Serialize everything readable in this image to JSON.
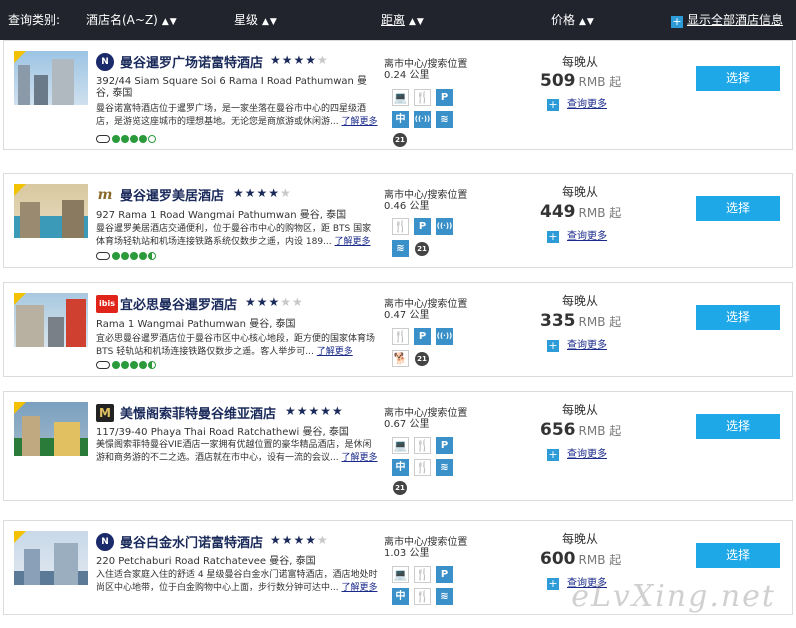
{
  "header": {
    "label": "查询类别:",
    "sort_name": "酒店名(A~Z)",
    "sort_star": "星级",
    "sort_distance": "距离",
    "sort_price": "价格",
    "sort_arrows": "▲▼",
    "show_all": "显示全部酒店信息"
  },
  "hotels": [
    {
      "name": "曼谷暹罗广场诺富特酒店",
      "brand": "N",
      "brand_color": "#1a2a6a",
      "stars": "★★★★",
      "stars_off": "★",
      "address": "392/44 Siam Square Soi 6 Rama I Road Pathumwan 曼谷, 泰国",
      "description": "曼谷诺富特酒店位于暹罗广场，是一家坐落在曼谷市中心的四星级酒店，是游览这座城市的理想基地。无论您是商旅游或休闲游...",
      "more": "了解更多",
      "distance_label": "离市中心/搜索位置",
      "distance": "0.24 公里",
      "price_label": "每晚从",
      "price": "509",
      "currency": "RMB 起",
      "query_more": "查询更多",
      "select": "选择"
    },
    {
      "name": "曼谷暹罗美居酒店",
      "brand": "m",
      "brand_color": "#ffffff",
      "stars": "★★★★",
      "stars_off": "★",
      "address": "927 Rama 1 Road Wangmai Pathumwan 曼谷, 泰国",
      "description": "曼谷暹罗美居酒店交通便利，位于曼谷市中心的购物区，距 BTS 国家体育场轻轨站和机场连接铁路系统仅数步之遥，内设 189...",
      "more": "了解更多",
      "distance_label": "离市中心/搜索位置",
      "distance": "0.46 公里",
      "price_label": "每晚从",
      "price": "449",
      "currency": "RMB 起",
      "query_more": "查询更多",
      "select": "选择"
    },
    {
      "name": "宜必思曼谷暹罗酒店",
      "brand": "ibis",
      "brand_color": "#e0241a",
      "stars": "★★★",
      "stars_off": "★★",
      "address": "Rama 1 Wangmai Pathumwan 曼谷, 泰国",
      "description": "宜必思曼谷暹罗酒店位于曼谷市区中心核心地段，距方便的国家体育场 BTS 轻轨站和机场连接铁路仅数步之遥。客人举步可...",
      "more": "了解更多",
      "distance_label": "离市中心/搜索位置",
      "distance": "0.47 公里",
      "price_label": "每晚从",
      "price": "335",
      "currency": "RMB 起",
      "query_more": "查询更多",
      "select": "选择"
    },
    {
      "name": "美憬阁索菲特曼谷维亚酒店",
      "brand": "M",
      "brand_color": "#222222",
      "stars": "★★★★★",
      "stars_off": "",
      "address": "117/39-40 Phaya Thai Road Ratchathewi 曼谷, 泰国",
      "description": "美憬阁索菲特曼谷VIE酒店一家拥有优越位置的豪华精品酒店，是休闲游和商务游的不二之选。酒店就在市中心，设有一流的会议...",
      "more": "了解更多",
      "distance_label": "离市中心/搜索位置",
      "distance": "0.67 公里",
      "price_label": "每晚从",
      "price": "656",
      "currency": "RMB 起",
      "query_more": "查询更多",
      "select": "选择"
    },
    {
      "name": "曼谷白金水门诺富特酒店",
      "brand": "N",
      "brand_color": "#1a2a6a",
      "stars": "★★★★",
      "stars_off": "★",
      "address": "220 Petchaburi Road Ratchatevee 曼谷, 泰国",
      "description": "入住适合家庭入住的舒适 4 星级曼谷白金水门诺富特酒店，酒店地处时尚区中心地带，位于白金购物中心上面，步行数分钟可达中...",
      "more": "了解更多",
      "distance_label": "离市中心/搜索位置",
      "distance": "1.03 公里",
      "price_label": "每晚从",
      "price": "600",
      "currency": "RMB 起",
      "query_more": "查询更多",
      "select": "选择"
    }
  ],
  "amenities": {
    "computer": "💻",
    "restaurant": "🍴",
    "parking": "P",
    "chinese": "中",
    "wifi": "((·))",
    "pool": "≋",
    "age21": "21",
    "pet": "🐕"
  },
  "watermark": "eLvXing.net"
}
